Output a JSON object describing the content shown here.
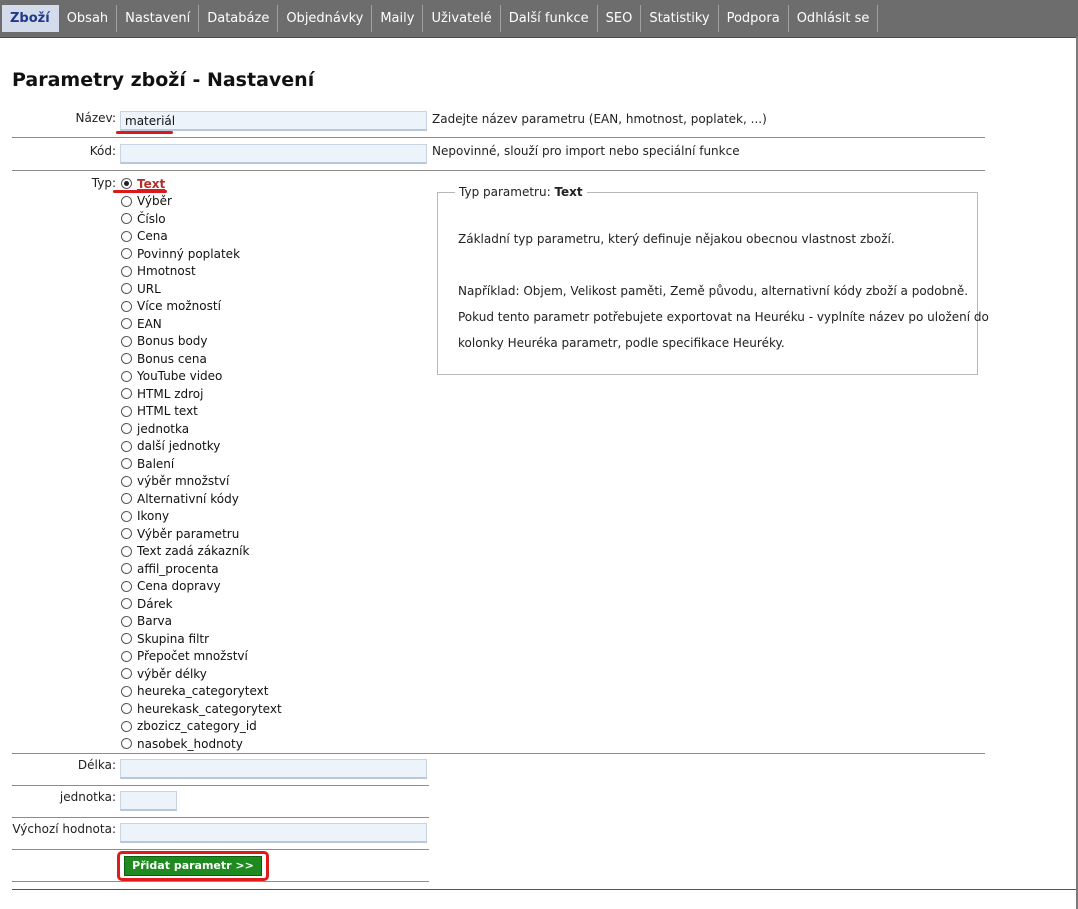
{
  "nav": {
    "tabs": [
      "Zboží",
      "Obsah",
      "Nastavení",
      "Databáze",
      "Objednávky",
      "Maily",
      "Uživatelé",
      "Další funkce",
      "SEO",
      "Statistiky",
      "Podpora",
      "Odhlásit se"
    ],
    "active_index": 0
  },
  "page": {
    "title": "Parametry zboží - Nastavení"
  },
  "form": {
    "name_label": "Název:",
    "name_value": "materiál",
    "name_hint": "Zadejte název parametru (EAN, hmotnost, poplatek, ...)",
    "code_label": "Kód:",
    "code_value": "",
    "code_hint": "Nepovinné, slouží pro import nebo speciální funkce",
    "type_label": "Typ:",
    "type_options": [
      "Text",
      "Výběr",
      "Číslo",
      "Cena",
      "Povinný poplatek",
      "Hmotnost",
      "URL",
      "Více možností",
      "EAN",
      "Bonus body",
      "Bonus cena",
      "YouTube video",
      "HTML zdroj",
      "HTML text",
      "jednotka",
      "další jednotky",
      "Balení",
      "výběr množství",
      "Alternativní kódy",
      "Ikony",
      "Výběr parametru",
      "Text zadá zákazník",
      "affil_procenta",
      "Cena dopravy",
      "Dárek",
      "Barva",
      "Skupina filtr",
      "Přepočet množství",
      "výběr délky",
      "heureka_categorytext",
      "heurekask_categorytext",
      "zbozicz_category_id",
      "nasobek_hodnoty"
    ],
    "type_selected_index": 0,
    "length_label": "Délka:",
    "length_value": "",
    "unit_label": "jednotka:",
    "unit_value": "",
    "default_label": "Výchozí hodnota:",
    "default_value": "",
    "submit_label": "Přidat parametr >>"
  },
  "type_info": {
    "legend_prefix": "Typ parametru:",
    "legend_type": "Text",
    "description": "Základní typ parametru, který definuje nějakou obecnou vlastnost zboží.",
    "example": "Například: Objem, Velikost paměti, Země původu, alternativní kódy zboží a podobně.",
    "heureka_line1": "Pokud tento parametr potřebujete exportovat na Heuréku - vyplníte název po uložení do",
    "heureka_line2": "kolonky Heuréka parametr, podle specifikace Heuréky."
  },
  "colors": {
    "accent": "#1f8a1f",
    "annotation": "#d9191c",
    "nav_bg": "#6d6d6d"
  }
}
